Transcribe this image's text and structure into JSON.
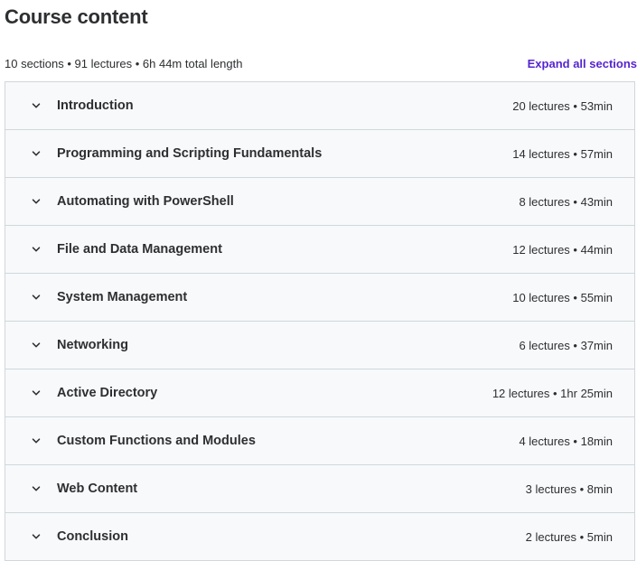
{
  "header": {
    "title": "Course content",
    "summary": "10 sections • 91 lectures • 6h 44m total length",
    "expand_all_label": "Expand all sections"
  },
  "colors": {
    "accent": "#5624d0",
    "section_bg": "#f7f9fa",
    "border": "#d1d7dc",
    "text": "#2d2f31"
  },
  "sections": [
    {
      "title": "Introduction",
      "meta": "20 lectures • 53min",
      "icon": "chevron-down-icon"
    },
    {
      "title": "Programming and Scripting Fundamentals",
      "meta": "14 lectures • 57min",
      "icon": "chevron-down-icon"
    },
    {
      "title": "Automating with PowerShell",
      "meta": "8 lectures • 43min",
      "icon": "chevron-down-icon"
    },
    {
      "title": "File and Data Management",
      "meta": "12 lectures • 44min",
      "icon": "chevron-down-icon"
    },
    {
      "title": "System Management",
      "meta": "10 lectures • 55min",
      "icon": "chevron-down-icon"
    },
    {
      "title": "Networking",
      "meta": "6 lectures • 37min",
      "icon": "chevron-down-icon"
    },
    {
      "title": "Active Directory",
      "meta": "12 lectures • 1hr 25min",
      "icon": "chevron-down-icon"
    },
    {
      "title": "Custom Functions and Modules",
      "meta": "4 lectures • 18min",
      "icon": "chevron-down-icon"
    },
    {
      "title": "Web Content",
      "meta": "3 lectures • 8min",
      "icon": "chevron-down-icon"
    },
    {
      "title": "Conclusion",
      "meta": "2 lectures • 5min",
      "icon": "chevron-down-icon"
    }
  ]
}
